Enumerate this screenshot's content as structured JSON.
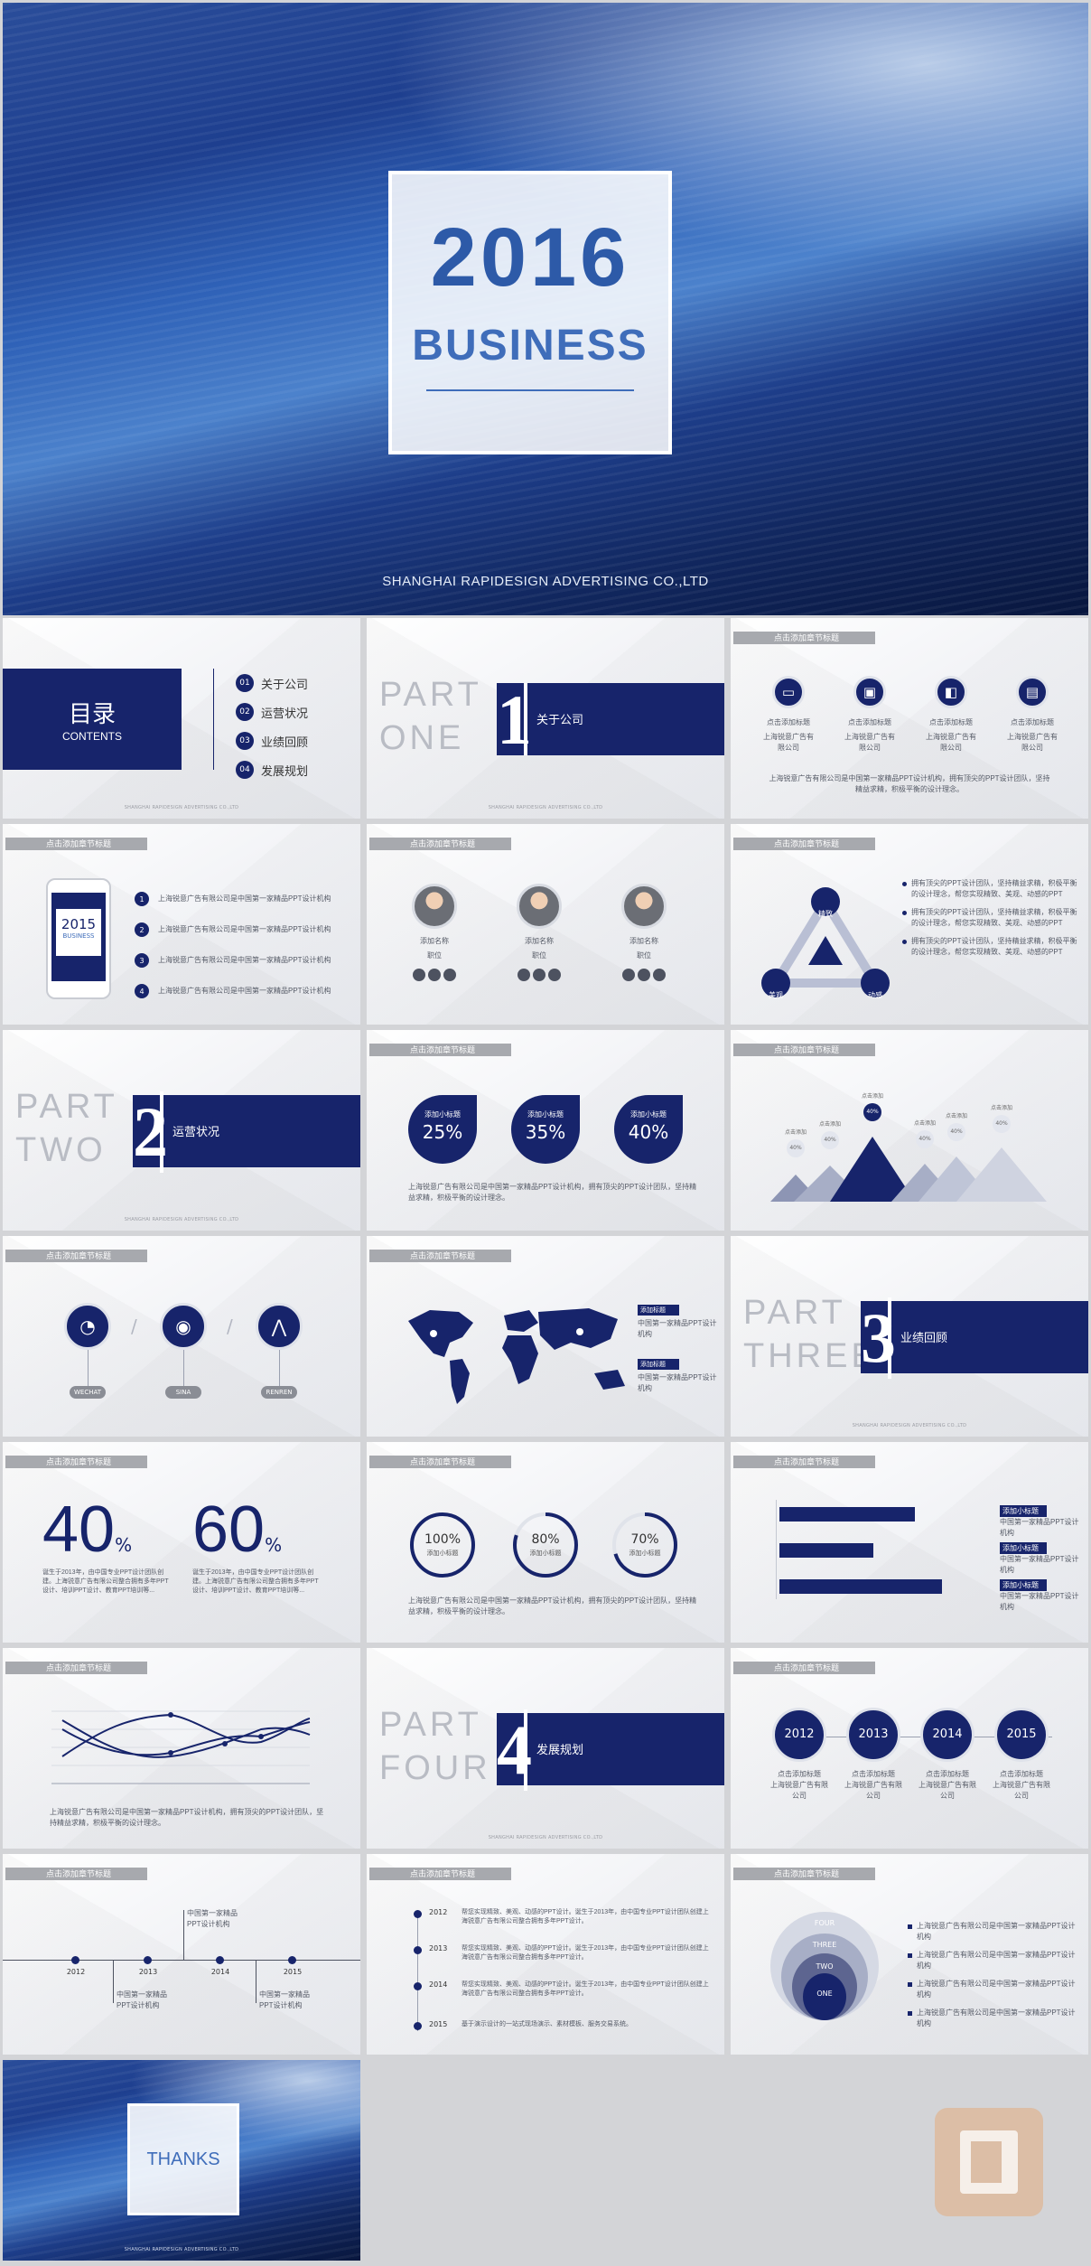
{
  "cover": {
    "year": "2016",
    "word": "BUSINESS",
    "company": "SHANGHAI RAPIDESIGN ADVERTISING CO.,LTD"
  },
  "tag": "点击添加章节标题",
  "footer": "SHANGHAI RAPIDESIGN ADVERTISING CO.,LTD",
  "contents": {
    "title": "目录",
    "subtitle": "CONTENTS",
    "items": [
      {
        "num": "01",
        "label": "关于公司"
      },
      {
        "num": "02",
        "label": "运营状况"
      },
      {
        "num": "03",
        "label": "业绩回顾"
      },
      {
        "num": "04",
        "label": "发展规划"
      }
    ]
  },
  "parts": [
    {
      "word1": "PART",
      "word2": "ONE",
      "num": "1",
      "label": "关于公司"
    },
    {
      "word1": "PART",
      "word2": "TWO",
      "num": "2",
      "label": "运营状况"
    },
    {
      "word1": "PART",
      "word2": "THREE",
      "num": "3",
      "label": "业绩回顾"
    },
    {
      "word1": "PART",
      "word2": "FOUR",
      "num": "4",
      "label": "发展规划"
    }
  ],
  "s3": {
    "items": [
      {
        "t": "点击添加标题",
        "d": "上海锐意广告有限公司"
      },
      {
        "t": "点击添加标题",
        "d": "上海锐意广告有限公司"
      },
      {
        "t": "点击添加标题",
        "d": "上海锐意广告有限公司"
      },
      {
        "t": "点击添加标题",
        "d": "上海锐意广告有限公司"
      }
    ],
    "para": "上海锐意广告有限公司是中国第一家精品PPT设计机构，拥有顶尖的PPT设计团队，坚持精益求精，积极平衡的设计理念。"
  },
  "s4": {
    "phone_year": "2015",
    "phone_word": "BUSINESS",
    "items": [
      "上海锐意广告有限公司是中国第一家精品PPT设计机构",
      "上海锐意广告有限公司是中国第一家精品PPT设计机构",
      "上海锐意广告有限公司是中国第一家精品PPT设计机构",
      "上海锐意广告有限公司是中国第一家精品PPT设计机构"
    ]
  },
  "s5": {
    "people": [
      {
        "name": "添加名称",
        "role": "职位"
      },
      {
        "name": "添加名称",
        "role": "职位"
      },
      {
        "name": "添加名称",
        "role": "职位"
      }
    ]
  },
  "s6": {
    "nodes": [
      "精致",
      "美观",
      "动感"
    ],
    "bullets": [
      "拥有顶尖的PPT设计团队，坚持精益求精，积极平衡的设计理念，帮您实现精致、美观、动感的PPT",
      "拥有顶尖的PPT设计团队，坚持精益求精，积极平衡的设计理念，帮您实现精致、美观、动感的PPT",
      "拥有顶尖的PPT设计团队，坚持精益求精，积极平衡的设计理念，帮您实现精致、美观、动感的PPT"
    ]
  },
  "s8": {
    "items": [
      {
        "label": "添加小标题",
        "value": "25%"
      },
      {
        "label": "添加小标题",
        "value": "35%"
      },
      {
        "label": "添加小标题",
        "value": "40%"
      }
    ],
    "para": "上海锐意广告有限公司是中国第一家精品PPT设计机构，拥有顶尖的PPT设计团队，坚持精益求精，积极平衡的设计理念。"
  },
  "s9": {
    "labels": [
      "点击添加",
      "点击添加",
      "点击添加",
      "点击添加",
      "点击添加",
      "点击添加"
    ],
    "values": [
      "40%",
      "40%",
      "40%",
      "40%",
      "40%",
      "40%"
    ]
  },
  "s10": {
    "items": [
      "WECHAT",
      "SINA",
      "RENREN"
    ]
  },
  "s11": {
    "blocks": [
      {
        "title": "添加标题",
        "text": "中国第一家精品PPT设计机构"
      },
      {
        "title": "添加标题",
        "text": "中国第一家精品PPT设计机构"
      }
    ]
  },
  "s13": {
    "items": [
      {
        "value": "40",
        "unit": "%",
        "text": "诞生于2013年，由中国专业PPT设计团队创建。上海锐意广告有限公司整合拥有多年PPT设计、培训PPT设计、教育PPT培训等..."
      },
      {
        "value": "60",
        "unit": "%",
        "text": "诞生于2013年，由中国专业PPT设计团队创建。上海锐意广告有限公司整合拥有多年PPT设计、培训PPT设计、教育PPT培训等..."
      }
    ]
  },
  "s14": {
    "rings": [
      {
        "value": "100%",
        "label": "添加小标题"
      },
      {
        "value": "80%",
        "label": "添加小标题"
      },
      {
        "value": "70%",
        "label": "添加小标题"
      }
    ],
    "para": "上海锐意广告有限公司是中国第一家精品PPT设计机构，拥有顶尖的PPT设计团队，坚持精益求精，积极平衡的设计理念。"
  },
  "s15": {
    "legend": [
      {
        "title": "添加小标题",
        "text": "中国第一家精品PPT设计机构"
      },
      {
        "title": "添加小标题",
        "text": "中国第一家精品PPT设计机构"
      },
      {
        "title": "添加小标题",
        "text": "中国第一家精品PPT设计机构"
      }
    ],
    "bars": [
      0.8,
      0.55,
      0.95
    ]
  },
  "s16": {
    "para": "上海锐意广告有限公司是中国第一家精品PPT设计机构，拥有顶尖的PPT设计团队，坚持精益求精，积极平衡的设计理念。"
  },
  "s18": {
    "years": [
      "2012",
      "2013",
      "2014",
      "2015"
    ],
    "title": "点击添加标题",
    "text": "上海锐意广告有限公司"
  },
  "s19": {
    "years": [
      "2012",
      "2013",
      "2014",
      "2015"
    ],
    "notes": [
      "中国第一家精品PPT设计机构",
      "中国第一家精品PPT设计机构",
      "中国第一家精品PPT设计机构"
    ]
  },
  "s20": {
    "items": [
      {
        "year": "2012",
        "text": "帮您实现精致、美观、动感的PPT设计。诞生于2013年，由中国专业PPT设计团队创建上海锐意广告有限公司整合拥有多年PPT设计。"
      },
      {
        "year": "2013",
        "text": "帮您实现精致、美观、动感的PPT设计。诞生于2013年，由中国专业PPT设计团队创建上海锐意广告有限公司整合拥有多年PPT设计。"
      },
      {
        "year": "2014",
        "text": "帮您实现精致、美观、动感的PPT设计。诞生于2013年，由中国专业PPT设计团队创建上海锐意广告有限公司整合拥有多年PPT设计。"
      },
      {
        "year": "2015",
        "text": "基于演示设计的一站式现场演示、素材模板、服务交易系统。"
      }
    ]
  },
  "s21": {
    "rings": [
      "FOUR",
      "THREE",
      "TWO",
      "ONE"
    ],
    "bullets": [
      "上海锐意广告有限公司是中国第一家精品PPT设计机构",
      "上海锐意广告有限公司是中国第一家精品PPT设计机构",
      "上海锐意广告有限公司是中国第一家精品PPT设计机构",
      "上海锐意广告有限公司是中国第一家精品PPT设计机构"
    ]
  },
  "thanks": {
    "word": "THANKS"
  },
  "colors": {
    "navy": "#17246b",
    "gray": "#a7a9ae",
    "stamp": "#e7a36b"
  }
}
